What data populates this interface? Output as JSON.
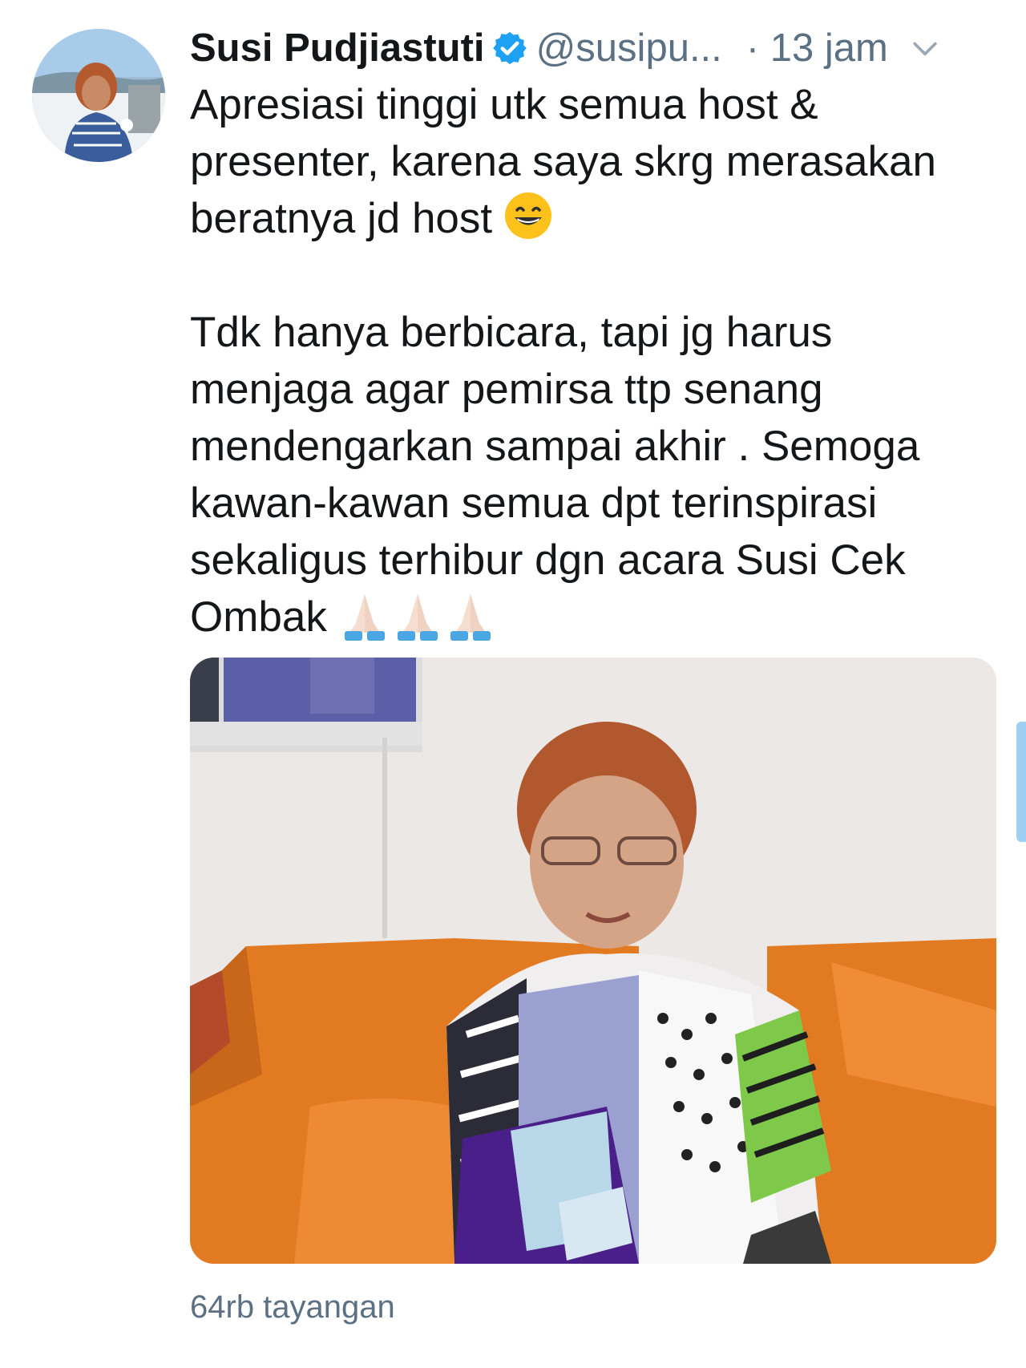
{
  "tweet": {
    "author_name": "Susi Pudjiastuti",
    "handle": "@susipu...",
    "time": "· 13 jam",
    "paragraph1": "Apresiasi tinggi utk semua host & presenter, karena saya skrg merasakan beratnya jd host",
    "paragraph2": "Tdk hanya berbicara, tapi jg harus menjaga agar pemirsa ttp senang mendengarkan sampai akhir . Semoga kawan-kawan semua dpt terinspirasi sekaligus terhibur dgn acara Susi Cek Ombak",
    "views": "64rb tayangan"
  },
  "icons": {
    "verified": "verified-badge-icon",
    "more": "chevron-down-icon",
    "emoji_grin": "grinning-face-emoji",
    "emoji_pray": "folded-hands-emoji"
  },
  "colors": {
    "text": "#14171a",
    "secondary": "#5b7083",
    "verified": "#1da1f2",
    "sofa": "#e8822a"
  }
}
